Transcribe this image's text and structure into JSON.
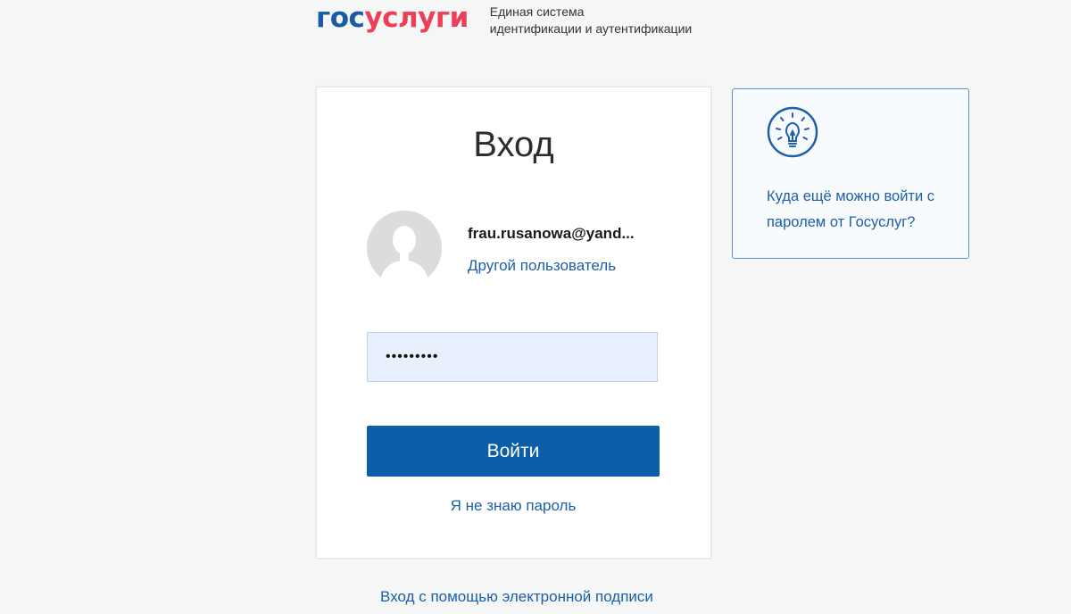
{
  "header": {
    "logo_part1": "гос",
    "logo_part2": "услуги",
    "tagline_line1": "Единая система",
    "tagline_line2": "идентификации и аутентификации"
  },
  "login": {
    "title": "Вход",
    "user_email": "frau.rusanowa@yand...",
    "other_user_label": "Другой пользователь",
    "password_value": "•••••••••",
    "submit_label": "Войти",
    "forgot_label": "Я не знаю пароль"
  },
  "footer": {
    "signature_link": "Вход с помощью электронной подписи"
  },
  "info": {
    "icon": "lightbulb-icon",
    "text": "Куда ещё можно войти с паролем от Госуслуг?"
  },
  "colors": {
    "brand_blue": "#1c5aa6",
    "brand_red": "#ee3f58",
    "button": "#0d5ea8",
    "link": "#1d5fa8",
    "input_bg": "#e8f0fd"
  }
}
